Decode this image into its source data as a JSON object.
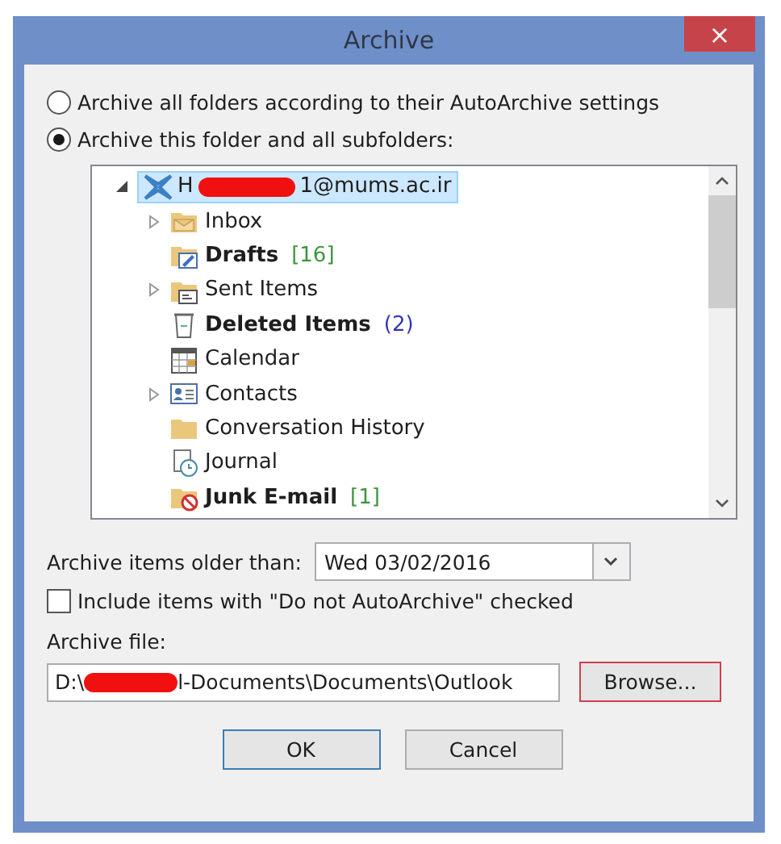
{
  "window": {
    "title": "Archive",
    "close": "×"
  },
  "options": [
    {
      "label": "Archive all folders according to their AutoArchive settings",
      "selected": false
    },
    {
      "label": "Archive this folder and all subfolders:",
      "selected": true
    }
  ],
  "tree": {
    "root": {
      "label_start": "H",
      "label_end": "1@mums.ac.ir",
      "expanded": true,
      "selected": true
    },
    "children": [
      {
        "kind": "inbox",
        "label": "Inbox",
        "bold": false,
        "has_children": true
      },
      {
        "kind": "drafts",
        "label": "Drafts",
        "bold": true,
        "count": "[16]",
        "color": "#3c963c",
        "has_children": false
      },
      {
        "kind": "sent",
        "label": "Sent Items",
        "bold": false,
        "has_children": true
      },
      {
        "kind": "deleted",
        "label": "Deleted Items",
        "bold": true,
        "count": "(2)",
        "color": "#3333bb",
        "has_children": false
      },
      {
        "kind": "calendar",
        "label": "Calendar",
        "bold": false,
        "has_children": false
      },
      {
        "kind": "contacts",
        "label": "Contacts",
        "bold": false,
        "has_children": true
      },
      {
        "kind": "folder",
        "label": "Conversation History",
        "bold": false,
        "has_children": false
      },
      {
        "kind": "journal",
        "label": "Journal",
        "bold": false,
        "has_children": false
      },
      {
        "kind": "junk",
        "label": "Junk E-mail",
        "bold": true,
        "count": "[1]",
        "color": "#3c963c",
        "has_children": false
      }
    ]
  },
  "older_than": {
    "label": "Archive items older than:",
    "value": "Wed 03/02/2016"
  },
  "include_checkbox": {
    "label": "Include items with \"Do not AutoArchive\" checked",
    "checked": false
  },
  "archive_file": {
    "label": "Archive file:",
    "value_start": "D:\\",
    "value_end": "l-Documents\\Documents\\Outlook",
    "browse": "Browse..."
  },
  "buttons": [
    {
      "label": "OK",
      "default": true
    },
    {
      "label": "Cancel",
      "default": false
    }
  ]
}
